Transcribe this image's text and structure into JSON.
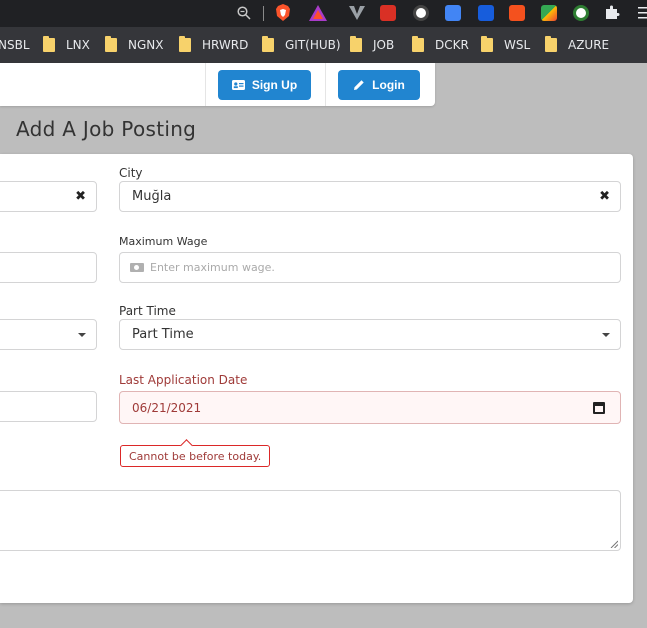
{
  "page": {
    "title": "Add A Job Posting"
  },
  "browser": {
    "bookmarks": [
      "NSBL",
      "LNX",
      "NGNX",
      "HRWRD",
      "GIT(HUB)",
      "JOB",
      "DCKR",
      "WSL",
      "AZURE"
    ],
    "extensions": [
      "zoom-icon",
      "brave-shield-icon",
      "brave-rewards-icon",
      "vivaldi-icon",
      "ext-red-icon",
      "ext-circle-icon",
      "google-translate-icon",
      "bitwarden-icon",
      "ext-orange-icon",
      "ext-colorful-icon",
      "ext-green-circle-icon",
      "puzzle-icon",
      "menu-icon"
    ]
  },
  "navbar": {
    "signup_label": "Sign Up",
    "login_label": "Login",
    "accent": "#2185d0"
  },
  "form": {
    "city": {
      "label": "City",
      "value": "Muğla",
      "clear_icon": "✖"
    },
    "max_wage": {
      "label": "Maximum Wage",
      "placeholder": "Enter maximum wage."
    },
    "part_time": {
      "label": "Part Time",
      "value": "Part Time"
    },
    "last_date": {
      "label": "Last Application Date",
      "value": "06/21/2021",
      "error": "Cannot be before today."
    },
    "left_clear_icon": "✖"
  }
}
